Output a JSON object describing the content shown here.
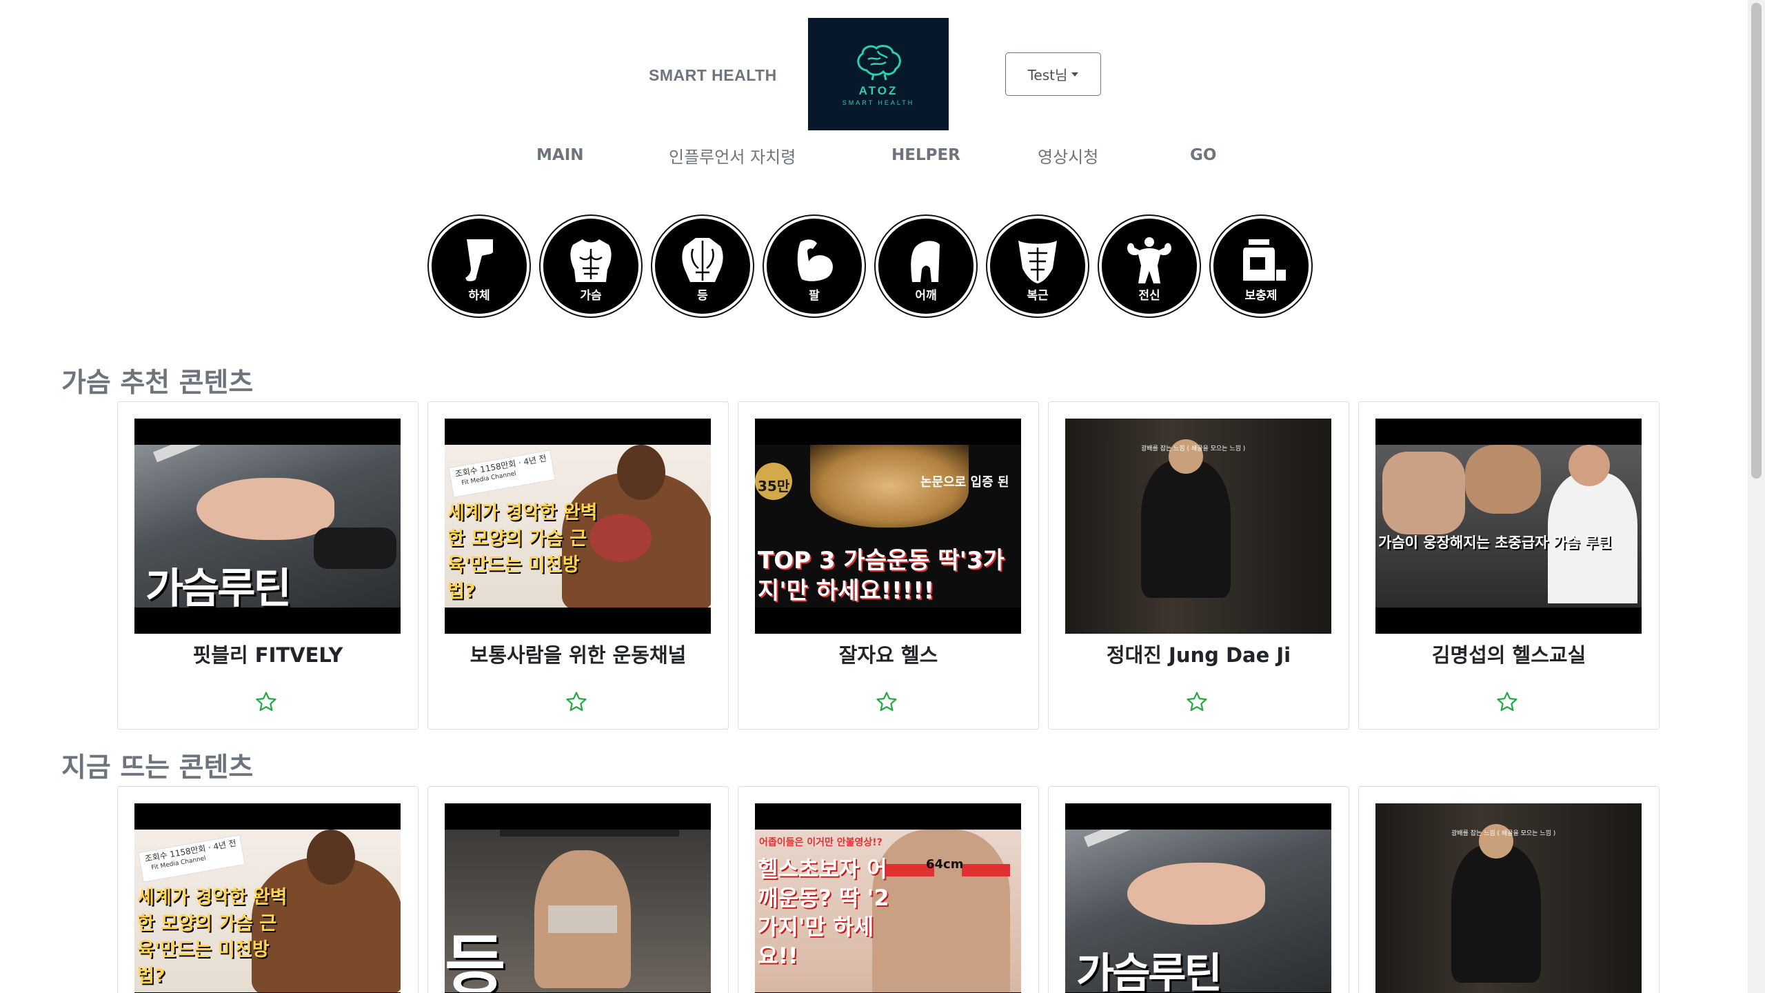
{
  "header": {
    "brand": "SMART HEALTH",
    "logo_title": "ATOZ",
    "logo_subtitle": "SMART HEALTH",
    "user_button": "Test님"
  },
  "nav": [
    "MAIN",
    "인플루언서 자치령",
    "HELPER",
    "영상시청",
    "GO"
  ],
  "categories": [
    "하체",
    "가슴",
    "등",
    "팔",
    "어깨",
    "복근",
    "전신",
    "보충제"
  ],
  "sections": [
    {
      "title": "가슴 추천 콘텐츠",
      "cards": [
        {
          "title": "핏블리 FITVELY",
          "thumb_text": "가슴루틴"
        },
        {
          "title": "보통사람을 위한 운동채널",
          "thumb_text": "세계가 경악한 완벽한 모양의 가슴 근육'만드는 미친방법?",
          "badge": "조회수 1158만회 · 4년 전",
          "channel": "Fit Media Channel"
        },
        {
          "title": "잘자요 헬스",
          "thumb_text": "TOP 3 가슴운동 딱'3가지'만 하세요!!!!!",
          "badge": "35만",
          "caption": "논문으로 입증 된"
        },
        {
          "title": "정대진 Jung Dae Ji",
          "caption": "광배를 잡는 느낌 ( 쇄골을 모으는 느낌 )"
        },
        {
          "title": "김명섭의 헬스교실",
          "thumb_text": "가슴이 웅장해지는 초중급자 가슴 루틴"
        }
      ]
    },
    {
      "title": "지금 뜨는 콘텐츠",
      "cards": [
        {
          "thumb_text": "세계가 경악한 완벽한 모양의 가슴 근육'만드는 미친방법?",
          "badge": "조회수 1158만회 · 4년 전",
          "channel": "Fit Media Channel"
        },
        {
          "thumb_text": "등"
        },
        {
          "thumb_text": "헬스초보자 어깨운동? 딱 '2가지'만 하세요!!",
          "caption": "어좁이들은 이거만 안볼영상!?",
          "badge": "64cm"
        },
        {
          "thumb_text": "가슴루틴"
        },
        {
          "caption": "광배를 잡는 느낌 ( 쇄골을 모으는 느낌 )"
        }
      ]
    }
  ],
  "colors": {
    "accent_star": "#28a745",
    "brand_teal": "#2ccfb0",
    "muted": "#6c757d"
  }
}
